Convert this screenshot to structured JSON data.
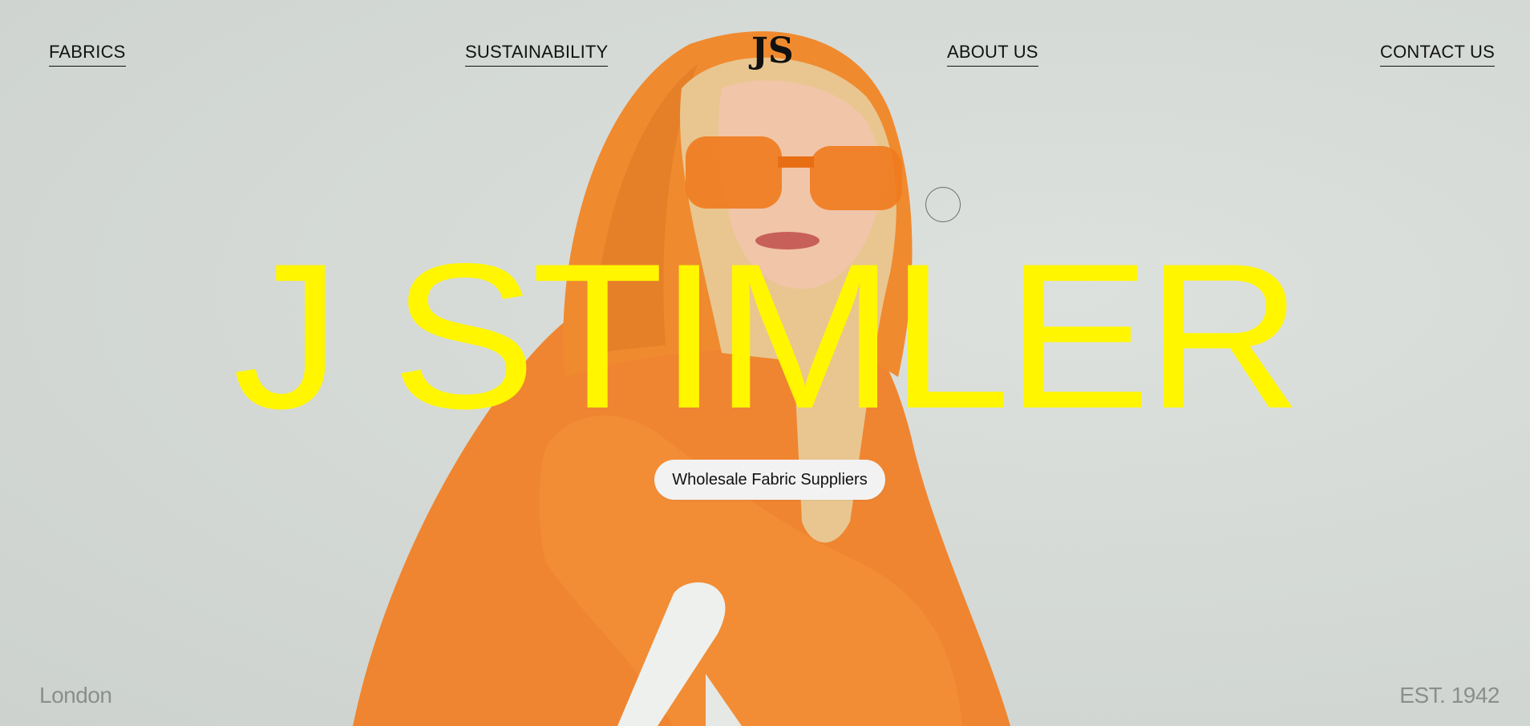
{
  "nav": {
    "left": [
      "FABRICS",
      "SUSTAINABILITY"
    ],
    "right": [
      "ABOUT US",
      "CONTACT US"
    ],
    "logo_text": "JS"
  },
  "hero": {
    "title": "J STIMLER",
    "tagline": "Wholesale Fabric Suppliers"
  },
  "footer": {
    "location": "London",
    "established": "EST. 1942"
  },
  "colors": {
    "title": "#fff600",
    "background": "#d6dbd7",
    "hoodie": "#f08a2f",
    "pill": "#f2f2f2"
  },
  "icons": {
    "logo": "js-monogram-icon",
    "cursor": "circle-cursor-icon"
  }
}
